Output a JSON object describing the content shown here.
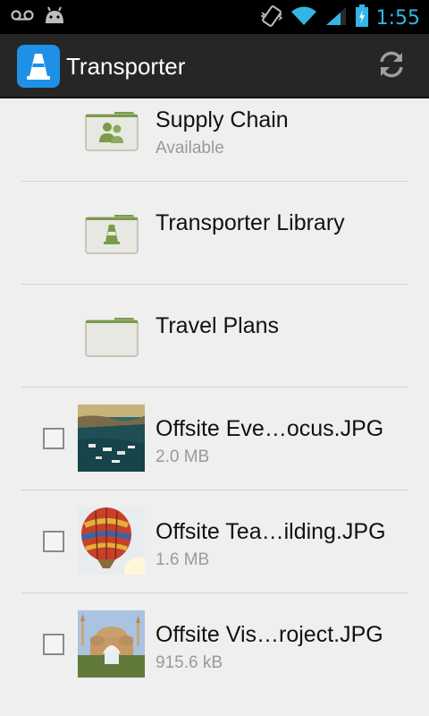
{
  "status_bar": {
    "time": "1:55",
    "icons": [
      "voicemail-icon",
      "android-icon",
      "vibrate-icon",
      "wifi-icon",
      "signal-icon",
      "battery-charging-icon"
    ]
  },
  "action_bar": {
    "title": "Transporter",
    "app_icon": "transporter-cone-icon",
    "refresh_icon": "refresh-icon"
  },
  "list": {
    "folders": [
      {
        "name": "Supply Chain",
        "status": "Available",
        "icon": "shared-folder-icon"
      },
      {
        "name": "Transporter Library",
        "status": "",
        "icon": "library-folder-icon"
      },
      {
        "name": "Travel Plans",
        "status": "",
        "icon": "folder-icon"
      }
    ],
    "files": [
      {
        "name": "Offsite Eve…ocus.JPG",
        "size": "2.0 MB",
        "thumb": "harbor-photo"
      },
      {
        "name": "Offsite Tea…ilding.JPG",
        "size": "1.6 MB",
        "thumb": "balloon-photo"
      },
      {
        "name": "Offsite Vis…roject.JPG",
        "size": "915.6 kB",
        "thumb": "mosque-photo"
      }
    ]
  },
  "colors": {
    "accent": "#33b5e5",
    "app_icon_bg": "#1e90e6",
    "folder_green": "#7a9b4a"
  }
}
